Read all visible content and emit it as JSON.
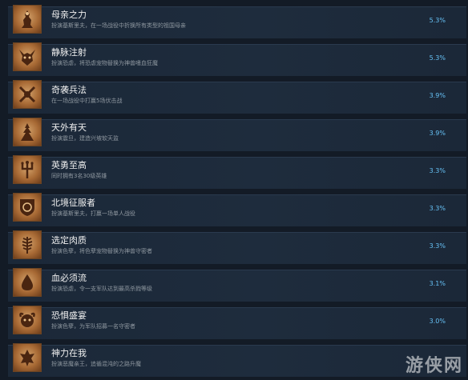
{
  "achievements": [
    {
      "title": "母亲之力",
      "desc": "扮演基斯里夫，在一场战役中折换所有类型的祖国母亲",
      "pct": "5.3%",
      "icon": "mother-statue-icon"
    },
    {
      "title": "静脉注射",
      "desc": "扮演恐虐，将恐虐宠物替换为神兽嗜血狂魔",
      "pct": "5.3%",
      "icon": "horned-skull-icon"
    },
    {
      "title": "奇袭兵法",
      "desc": "在一场战役中打赢5场伏击战",
      "pct": "3.9%",
      "icon": "crossed-blades-icon"
    },
    {
      "title": "天外有天",
      "desc": "扮演震旦，建造兴坡软天监",
      "pct": "3.9%",
      "icon": "pagoda-icon"
    },
    {
      "title": "英勇至高",
      "desc": "同时拥有3名30级英雄",
      "pct": "3.3%",
      "icon": "trident-icon"
    },
    {
      "title": "北境征服者",
      "desc": "扮演基斯里夫，打赢一场单人战役",
      "pct": "3.3%",
      "icon": "bear-shield-icon"
    },
    {
      "title": "选定肉质",
      "desc": "扮演色孽，将色孽宠物替换为神兽守密者",
      "pct": "3.3%",
      "icon": "wheat-icon"
    },
    {
      "title": "血必须流",
      "desc": "扮演恐虐，令一支军队达到最高杀戮等级",
      "pct": "3.1%",
      "icon": "blood-drop-icon"
    },
    {
      "title": "恐惧盛宴",
      "desc": "扮演色孽，为军队招募一名守密者",
      "pct": "3.0%",
      "icon": "demon-face-icon"
    },
    {
      "title": "神力在我",
      "desc": "扮演恶魔亲王，追循混沌的之路升魔",
      "pct": "",
      "icon": "daemon-prince-icon"
    }
  ],
  "watermark": "游侠网"
}
